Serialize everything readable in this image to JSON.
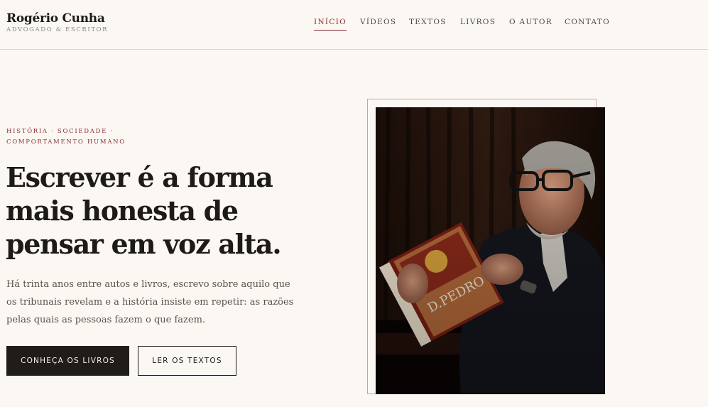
{
  "brand": {
    "name": "Rogério Cunha",
    "tagline": "ADVOGADO & ESCRITOR"
  },
  "nav": {
    "items": [
      {
        "label": "INÍCIO",
        "active": true
      },
      {
        "label": "VÍDEOS",
        "active": false
      },
      {
        "label": "TEXTOS",
        "active": false
      },
      {
        "label": "LIVROS",
        "active": false
      },
      {
        "label": "O AUTOR",
        "active": false
      },
      {
        "label": "CONTATO",
        "active": false
      }
    ]
  },
  "hero": {
    "eyebrow_line1": "HISTÓRIA · SOCIEDADE ·",
    "eyebrow_line2": "COMPORTAMENTO HUMANO",
    "headline_line1": "Escrever é a forma",
    "headline_line2": "mais honesta de",
    "headline_line3": "pensar em voz alta.",
    "lede": "Há trinta anos entre autos e livros, escrevo sobre aquilo que os tribunais revelam e a história insiste em repetir: as razões pelas quais as pessoas fazem o que fazem.",
    "primary_button": "CONHEÇA OS LIVROS",
    "secondary_button": "LER OS TEXTOS"
  },
  "photo": {
    "book_title": "D.PEDRO"
  },
  "colors": {
    "background": "#fbf8f3",
    "accent": "#8a2f35",
    "text": "#1d1a17",
    "button_dark": "#1f1c19"
  }
}
